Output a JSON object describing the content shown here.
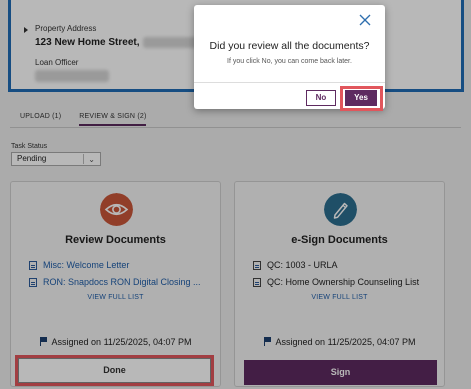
{
  "property": {
    "address_label": "Property Address",
    "address_value": "123 New Home Street,",
    "loan_officer_label": "Loan Officer"
  },
  "tabs": [
    {
      "label": "UPLOAD (1)",
      "active": false
    },
    {
      "label": "REVIEW & SIGN (2)",
      "active": true
    }
  ],
  "task_status": {
    "label": "Task Status",
    "value": "Pending"
  },
  "review_card": {
    "title": "Review Documents",
    "icon": "eye-icon",
    "items": [
      "Misc: Welcome Letter",
      "RON: Snapdocs RON Digital Closing ..."
    ],
    "view_full": "VIEW FULL LIST",
    "assigned": "Assigned on 11/25/2025, 04:07 PM",
    "button": "Done"
  },
  "sign_card": {
    "title": "e-Sign Documents",
    "icon": "pen-icon",
    "items": [
      "QC: 1003 - URLA",
      "QC: Home Ownership Counseling List"
    ],
    "view_full": "VIEW FULL LIST",
    "assigned": "Assigned on 11/25/2025, 04:07 PM",
    "button": "Sign"
  },
  "modal": {
    "title": "Did you review all the documents?",
    "subtitle": "If you click No, you can come back later.",
    "no_label": "No",
    "yes_label": "Yes"
  },
  "colors": {
    "primary": "#5e2a60",
    "link": "#1f5da8",
    "highlight": "#e1565c",
    "panel_border": "#1f6bb5",
    "eye_circle": "#c9573a",
    "pen_circle": "#2b6e8f"
  }
}
